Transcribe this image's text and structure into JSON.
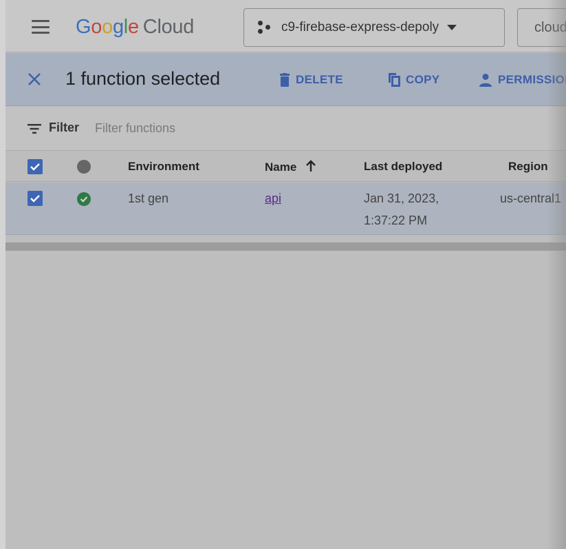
{
  "header": {
    "logo": {
      "g1": "G",
      "o1": "o",
      "o2": "o",
      "g2": "g",
      "l": "l",
      "e": "e",
      "suffix": "Cloud"
    },
    "project_name": "c9-firebase-express-depoly",
    "search_text": "cloud"
  },
  "selection_bar": {
    "title": "1 function selected",
    "delete_label": "DELETE",
    "copy_label": "COPY",
    "permissions_label": "PERMISSIONS"
  },
  "filter": {
    "label": "Filter",
    "placeholder": "Filter functions"
  },
  "table": {
    "columns": {
      "environment": "Environment",
      "name": "Name",
      "last_deployed": "Last deployed",
      "region": "Region"
    },
    "rows": [
      {
        "environment": "1st gen",
        "name": "api",
        "last_deployed_date": "Jan 31, 2023,",
        "last_deployed_time": "1:37:22 PM",
        "region": "us-central1"
      }
    ]
  },
  "colors": {
    "selection_bar": "#a6b0bf",
    "action_blue": "#3d5fa8",
    "checkbox_blue": "#3d66b5",
    "status_green": "#2f7a45"
  }
}
